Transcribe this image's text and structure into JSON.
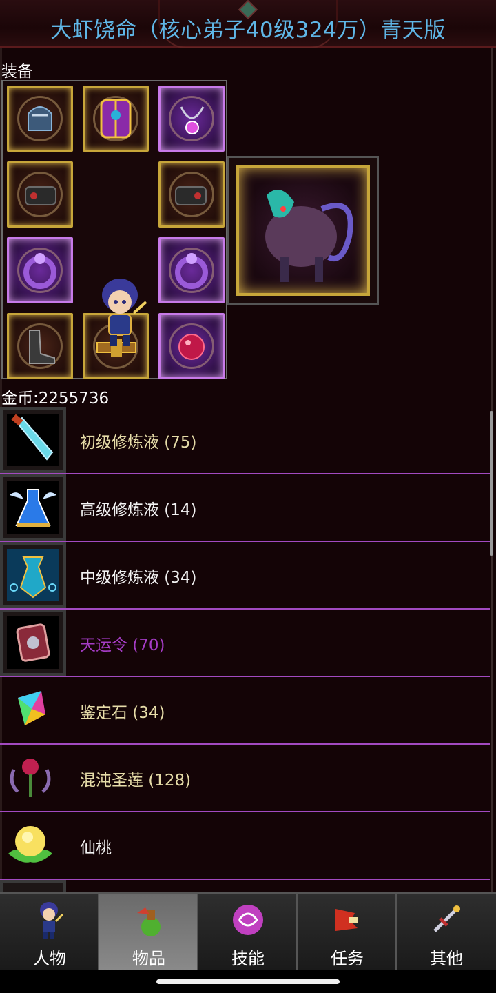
{
  "header": {
    "title": "大虾饶命（核心弟子40级324万）青天版"
  },
  "equipment": {
    "label": "装备",
    "slots": [
      {
        "icon": "helmet-icon",
        "tone": "gold"
      },
      {
        "icon": "armor-icon",
        "tone": "gold"
      },
      {
        "icon": "necklace-icon",
        "tone": "purple"
      },
      {
        "icon": "bracer-left-icon",
        "tone": "gold"
      },
      {
        "icon": "bracer-right-icon",
        "tone": "gold"
      },
      {
        "icon": "ring-left-icon",
        "tone": "purple"
      },
      {
        "icon": "ring-right-icon",
        "tone": "purple"
      },
      {
        "icon": "boots-icon",
        "tone": "gold"
      },
      {
        "icon": "belt-icon",
        "tone": "gold"
      },
      {
        "icon": "gem-icon",
        "tone": "purple"
      }
    ],
    "pet_icon": "beast-mount-icon"
  },
  "gold": {
    "text": "金币:2255736"
  },
  "items": [
    {
      "name": "初级修炼液 (75)",
      "icon": "potion-vial-icon",
      "color": "#e6dca8"
    },
    {
      "name": "高级修炼液 (14)",
      "icon": "winged-flask-icon",
      "color": "#f2f2f2"
    },
    {
      "name": "中级修炼液 (34)",
      "icon": "ornate-flask-icon",
      "color": "#f2f2f2"
    },
    {
      "name": "天运令 (70)",
      "icon": "token-icon",
      "color": "#a43cc4"
    },
    {
      "name": "鉴定石 (34)",
      "icon": "rainbow-crystal-icon",
      "color": "#e6dca8"
    },
    {
      "name": "混沌圣莲 (128)",
      "icon": "chaos-lotus-icon",
      "color": "#e6dca8"
    },
    {
      "name": "仙桃",
      "icon": "peach-icon",
      "color": "#f2f2f2"
    }
  ],
  "tabs": [
    {
      "label": "人物",
      "icon": "character-icon",
      "active": false
    },
    {
      "label": "物品",
      "icon": "potion-bag-icon",
      "active": true
    },
    {
      "label": "技能",
      "icon": "skill-orb-icon",
      "active": false
    },
    {
      "label": "任务",
      "icon": "quest-flag-icon",
      "active": false
    },
    {
      "label": "其他",
      "icon": "sword-icon",
      "active": false
    }
  ]
}
